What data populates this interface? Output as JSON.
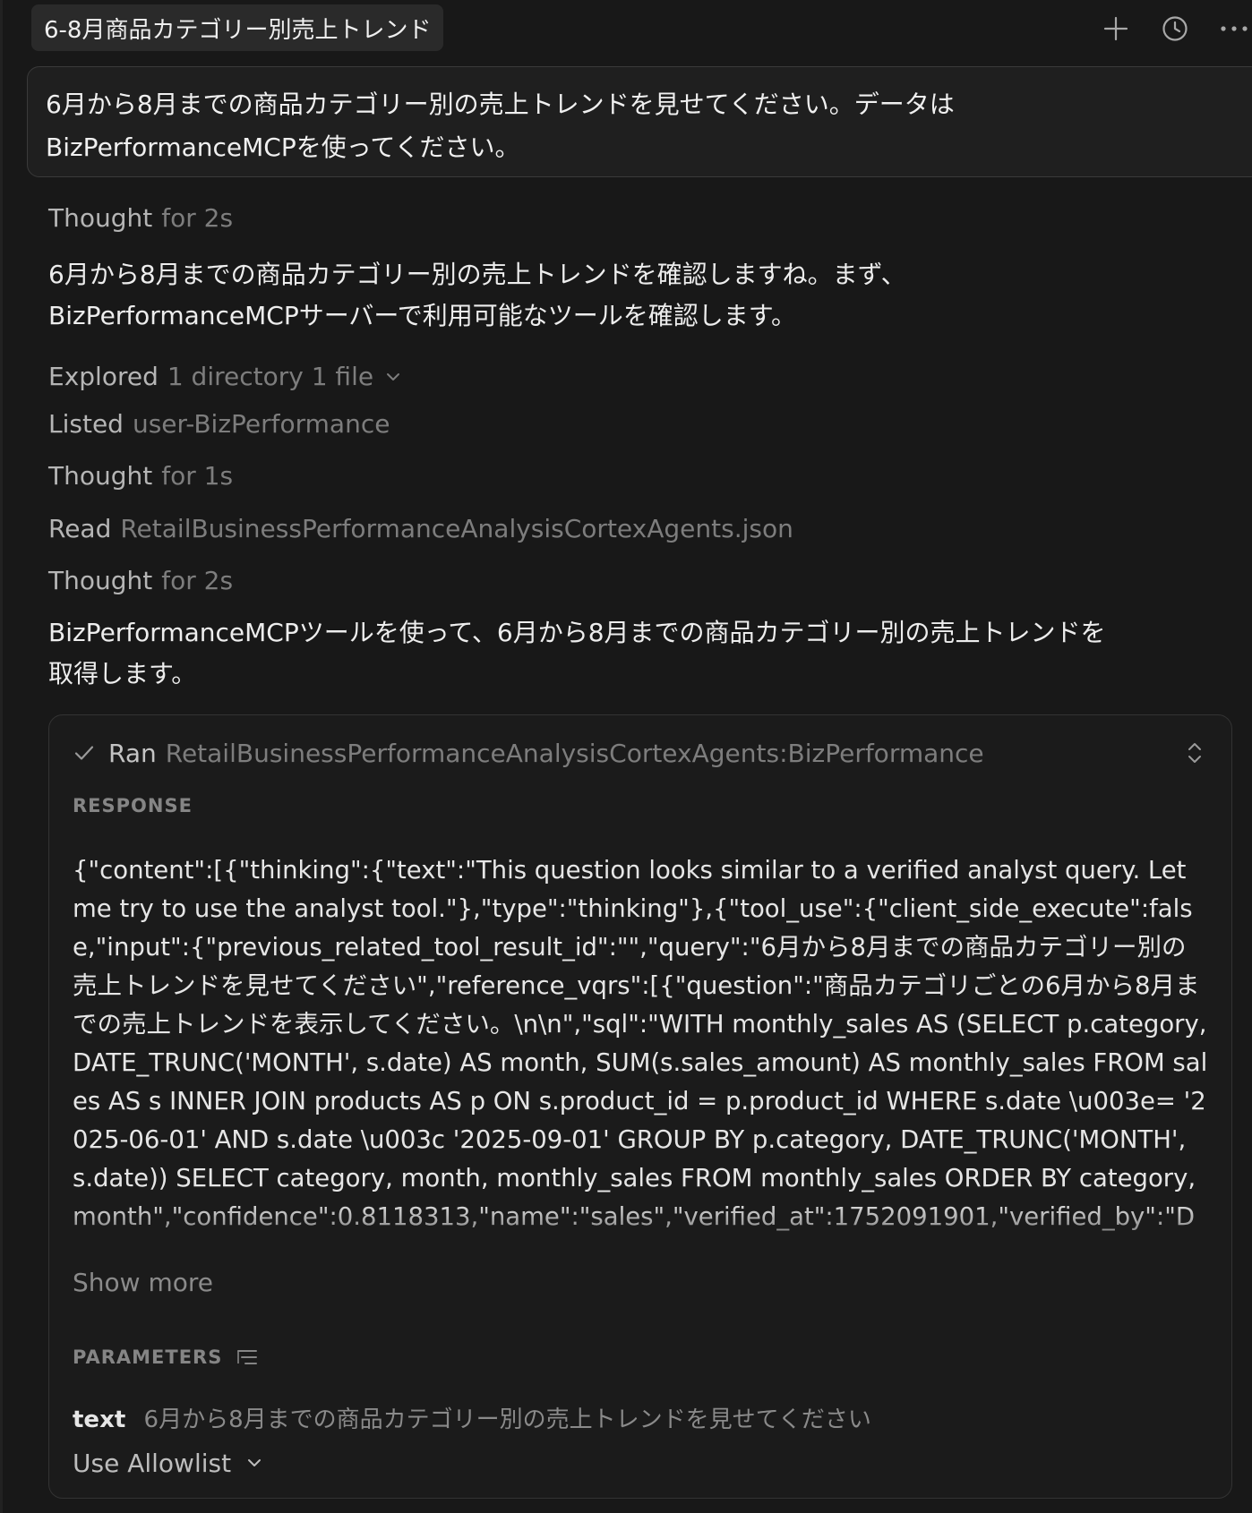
{
  "header": {
    "chat_title": "6-8月商品カテゴリー別売上トレンド",
    "icons": [
      "plus-icon",
      "history-icon",
      "more-icon"
    ]
  },
  "user_message": "6月から8月までの商品カテゴリー別の売上トレンドを見せてください。データは\nBizPerformanceMCPを使ってください。",
  "timeline": {
    "thought1": {
      "verb": "Thought",
      "detail": "for 2s"
    },
    "assistant1": "6月から8月までの商品カテゴリー別の売上トレンドを確認しますね。まず、\nBizPerformanceMCPサーバーで利用可能なツールを確認します。",
    "explored": {
      "verb": "Explored",
      "detail": "1 directory 1 file"
    },
    "listed": {
      "verb": "Listed",
      "detail": "user-BizPerformance"
    },
    "thought2": {
      "verb": "Thought",
      "detail": "for 1s"
    },
    "read": {
      "verb": "Read",
      "detail": "RetailBusinessPerformanceAnalysisCortexAgents.json"
    },
    "thought3": {
      "verb": "Thought",
      "detail": "for 2s"
    },
    "assistant2": "BizPerformanceMCPツールを使って、6月から8月までの商品カテゴリー別の売上トレンドを\n取得します。"
  },
  "tool_call": {
    "status_verb": "Ran",
    "tool_name": "RetailBusinessPerformanceAnalysisCortexAgents:BizPerformance",
    "response_label": "RESPONSE",
    "response_text": "{\"content\":[{\"thinking\":{\"text\":\"This question looks similar to a verified analyst query. Let me try to use the analyst tool.\"},\"type\":\"thinking\"},{\"tool_use\":{\"client_side_execute\":false,\"input\":{\"previous_related_tool_result_id\":\"\",\"query\":\"6月から8月までの商品カテゴリー別の売上トレンドを見せてください\",\"reference_vqrs\":[{\"question\":\"商品カテゴリごとの6月から8月までの売上トレンドを表示してください。\\n\\n\",\"sql\":\"WITH monthly_sales AS (SELECT p.category, DATE_TRUNC('MONTH', s.date) AS month, SUM(s.sales_amount) AS monthly_sales FROM sales AS s INNER JOIN products AS p ON s.product_id = p.product_id WHERE s.date \\u003e= '2025-06-01' AND s.date \\u003c '2025-09-01' GROUP BY p.category, DATE_TRUNC('MONTH', s.date)) SELECT category, month, monthly_sales FROM monthly_sales ORDER BY category, month\",\"confidence\":0.8118313,\"name\":\"sales\",\"verified_at\":1752091901,\"verified_by\":\"D",
    "show_more_label": "Show more",
    "parameters_label": "PARAMETERS",
    "parameters": [
      {
        "key": "text",
        "value": "6月から8月までの商品カテゴリー別の売上トレンドを見せてください"
      }
    ],
    "allowlist_label": "Use Allowlist"
  },
  "colors": {
    "background": "#181818",
    "card": "#1b1b1b",
    "muted_text": "#7d7d7d",
    "primary_text": "#ededed"
  }
}
